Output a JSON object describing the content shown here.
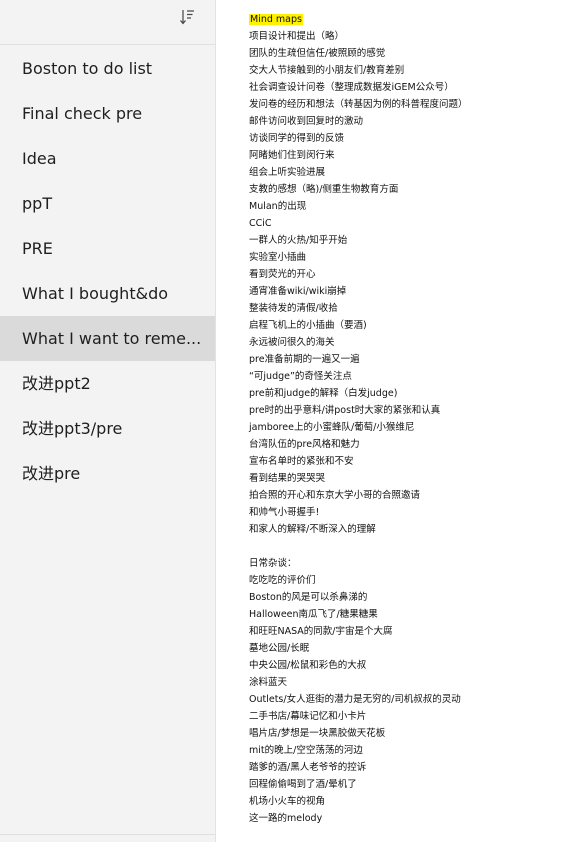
{
  "sidebar": {
    "sort_icon": "sort-lines-icon",
    "notes": [
      {
        "label": "Boston to do list"
      },
      {
        "label": "Final check pre"
      },
      {
        "label": "Idea"
      },
      {
        "label": "ppT"
      },
      {
        "label": "PRE"
      },
      {
        "label": "What I bought&do"
      },
      {
        "label": "What I want to reme..."
      },
      {
        "label": "改进ppt2"
      },
      {
        "label": "改进ppt3/pre"
      },
      {
        "label": "改进pre"
      }
    ],
    "selected_index": 6
  },
  "note": {
    "heading": "Mind maps",
    "highlight_color": "#fff200",
    "section1": [
      "项目设计和提出（略）",
      "团队的生疏但信任/被照顾的感觉",
      "交大人节接触到的小朋友们/教育差别",
      "社会调查设计问卷（整理成数据发iGEM公众号）",
      "发问卷的经历和想法（转基因为例的科普程度问题）",
      "邮件访问收到回复时的激动",
      "访谈同学的得到的反馈",
      "阿睹她们住到闵行来",
      "组会上听实验进展",
      "支教的感想（略)/侧重生物教育方面",
      "Mulan的出现",
      "CCiC",
      "一群人的火热/知乎开始",
      "实验室小插曲",
      "看到荧光的开心",
      "通宵准备wiki/wiki崩掉",
      "整装待发的清假/收拾",
      "启程飞机上的小插曲（要酒)",
      "永远被问很久的海关",
      "pre准备前期的一遍又一遍",
      "“可judge”的奇怪关注点",
      "pre前和judge的解释（白发judge)",
      "pre时的出乎意料/讲post时大家的紧张和认真",
      "jamboree上的小蜜蜂队/葡萄/小猴维尼",
      "台湾队伍的pre风格和魅力",
      "宣布名单时的紧张和不安",
      "看到结果的哭哭哭",
      "拍合照的开心和东京大学小哥的合照邀请",
      "和帅气小哥握手!",
      "和家人的解释/不断深入的理解"
    ],
    "section2_title": "日常杂谈：",
    "section2": [
      "吃吃吃的评价们",
      "Boston的风是可以杀鼻涕的",
      "Halloween南瓜飞了/糖果糖果",
      "和旺旺NASA的同款/宇宙是个大腐",
      "墓地公园/长眠",
      "中央公园/松鼠和彩色的大叔",
      "涂料蓝天",
      "Outlets/女人逛街的潜力是无穷的/司机叔叔的灵动",
      "二手书店/幕味记忆和小卡片",
      "唱片店/梦想是一块黑胶做天花板",
      "mit的晚上/空空荡荡的河边",
      "踏爹的酒/黑人老爷爷的控诉",
      "回程偷偷喝到了酒/晕机了",
      "机场小火车的视角",
      "这一路的melody"
    ]
  }
}
